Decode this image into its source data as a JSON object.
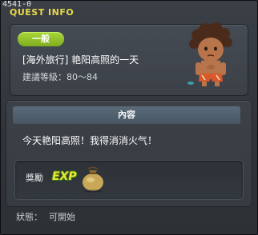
{
  "window": {
    "id_label": "4541-0",
    "title": "QUEST INFO"
  },
  "summary": {
    "category_badge": "一般",
    "quest_name": "[海外旅行] 艳阳高照的一天",
    "level_label": "建議等級",
    "level_range": "80～84",
    "npc_icon": "npc-portrait-icon"
  },
  "content": {
    "header": "內容",
    "text": "今天艳阳高照！我得消消火气！"
  },
  "reward": {
    "label": "獎勵",
    "exp_text": "EXP",
    "item_icon": "money-bag-icon"
  },
  "status": {
    "label": "狀態",
    "value": "可開始"
  },
  "colors": {
    "title": "#e8d84a",
    "badge": "#8fc22a",
    "panel": "#3c4148"
  }
}
